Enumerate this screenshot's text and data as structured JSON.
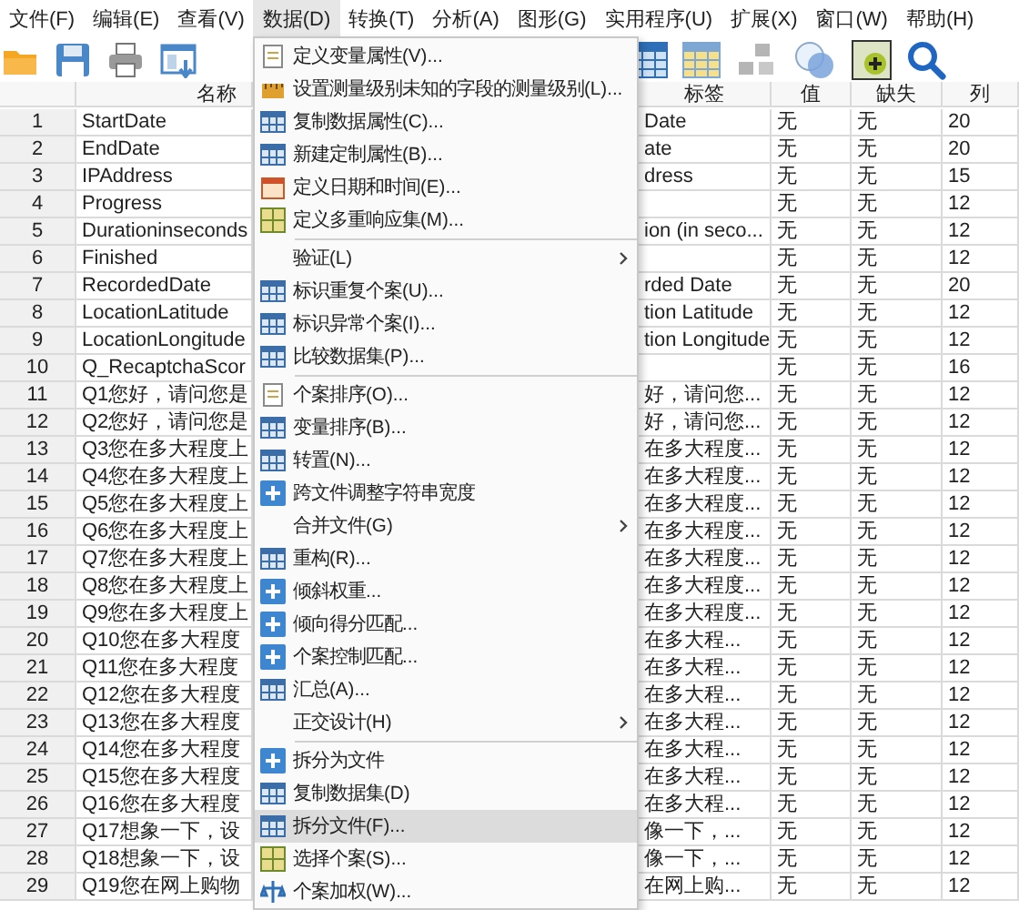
{
  "menu_bar": [
    {
      "label": "文件(F)",
      "selected": false
    },
    {
      "label": "编辑(E)",
      "selected": false
    },
    {
      "label": "查看(V)",
      "selected": false
    },
    {
      "label": "数据(D)",
      "selected": true
    },
    {
      "label": "转换(T)",
      "selected": false
    },
    {
      "label": "分析(A)",
      "selected": false
    },
    {
      "label": "图形(G)",
      "selected": false
    },
    {
      "label": "实用程序(U)",
      "selected": false
    },
    {
      "label": "扩展(X)",
      "selected": false
    },
    {
      "label": "窗口(W)",
      "selected": false
    },
    {
      "label": "帮助(H)",
      "selected": false
    }
  ],
  "table": {
    "columns": [
      "名称",
      "标签",
      "值",
      "缺失",
      "列"
    ],
    "rows": [
      {
        "number": "1",
        "name": "StartDate",
        "label": "Date",
        "values": "无",
        "missing": "无",
        "columns": "20"
      },
      {
        "number": "2",
        "name": "EndDate",
        "label": "ate",
        "values": "无",
        "missing": "无",
        "columns": "20"
      },
      {
        "number": "3",
        "name": "IPAddress",
        "label": "dress",
        "values": "无",
        "missing": "无",
        "columns": "15"
      },
      {
        "number": "4",
        "name": "Progress",
        "label": "",
        "values": "无",
        "missing": "无",
        "columns": "12"
      },
      {
        "number": "5",
        "name": "Durationinseconds",
        "label": "ion (in seco...",
        "values": "无",
        "missing": "无",
        "columns": "12"
      },
      {
        "number": "6",
        "name": "Finished",
        "label": "",
        "values": "无",
        "missing": "无",
        "columns": "12"
      },
      {
        "number": "7",
        "name": "RecordedDate",
        "label": "rded Date",
        "values": "无",
        "missing": "无",
        "columns": "20"
      },
      {
        "number": "8",
        "name": "LocationLatitude",
        "label": "tion Latitude",
        "values": "无",
        "missing": "无",
        "columns": "12"
      },
      {
        "number": "9",
        "name": "LocationLongitude",
        "label": "tion Longitude",
        "values": "无",
        "missing": "无",
        "columns": "12"
      },
      {
        "number": "10",
        "name": "Q_RecaptchaScor",
        "label": "",
        "values": "无",
        "missing": "无",
        "columns": "16"
      },
      {
        "number": "11",
        "name": "Q1您好，请问您是",
        "label": "好，请问您...",
        "values": "无",
        "missing": "无",
        "columns": "12"
      },
      {
        "number": "12",
        "name": "Q2您好，请问您是",
        "label": "好，请问您...",
        "values": "无",
        "missing": "无",
        "columns": "12"
      },
      {
        "number": "13",
        "name": "Q3您在多大程度上",
        "label": "在多大程度...",
        "values": "无",
        "missing": "无",
        "columns": "12"
      },
      {
        "number": "14",
        "name": "Q4您在多大程度上",
        "label": "在多大程度...",
        "values": "无",
        "missing": "无",
        "columns": "12"
      },
      {
        "number": "15",
        "name": "Q5您在多大程度上",
        "label": "在多大程度...",
        "values": "无",
        "missing": "无",
        "columns": "12"
      },
      {
        "number": "16",
        "name": "Q6您在多大程度上",
        "label": "在多大程度...",
        "values": "无",
        "missing": "无",
        "columns": "12"
      },
      {
        "number": "17",
        "name": "Q7您在多大程度上",
        "label": "在多大程度...",
        "values": "无",
        "missing": "无",
        "columns": "12"
      },
      {
        "number": "18",
        "name": "Q8您在多大程度上",
        "label": "在多大程度...",
        "values": "无",
        "missing": "无",
        "columns": "12"
      },
      {
        "number": "19",
        "name": "Q9您在多大程度上",
        "label": "在多大程度...",
        "values": "无",
        "missing": "无",
        "columns": "12"
      },
      {
        "number": "20",
        "name": "Q10您在多大程度",
        "label": "在多大程...",
        "values": "无",
        "missing": "无",
        "columns": "12"
      },
      {
        "number": "21",
        "name": "Q11您在多大程度",
        "label": "在多大程...",
        "values": "无",
        "missing": "无",
        "columns": "12"
      },
      {
        "number": "22",
        "name": "Q12您在多大程度",
        "label": "在多大程...",
        "values": "无",
        "missing": "无",
        "columns": "12"
      },
      {
        "number": "23",
        "name": "Q13您在多大程度",
        "label": "在多大程...",
        "values": "无",
        "missing": "无",
        "columns": "12"
      },
      {
        "number": "24",
        "name": "Q14您在多大程度",
        "label": "在多大程...",
        "values": "无",
        "missing": "无",
        "columns": "12"
      },
      {
        "number": "25",
        "name": "Q15您在多大程度",
        "label": "在多大程...",
        "values": "无",
        "missing": "无",
        "columns": "12"
      },
      {
        "number": "26",
        "name": "Q16您在多大程度",
        "label": "在多大程...",
        "values": "无",
        "missing": "无",
        "columns": "12"
      },
      {
        "number": "27",
        "name": "Q17想象一下，设",
        "label": "像一下，...",
        "values": "无",
        "missing": "无",
        "columns": "12"
      },
      {
        "number": "28",
        "name": "Q18想象一下，设",
        "label": "像一下，...",
        "values": "无",
        "missing": "无",
        "columns": "12"
      },
      {
        "number": "29",
        "name": "Q19您在网上购物",
        "label": "在网上购...",
        "values": "无",
        "missing": "无",
        "columns": "12"
      }
    ]
  },
  "data_menu": {
    "sections": [
      [
        {
          "label": "定义变量属性(V)...",
          "kind": "command",
          "selected": false
        },
        {
          "label": "设置测量级别未知的字段的测量级别(L)...",
          "kind": "command",
          "selected": false
        },
        {
          "label": "复制数据属性(C)...",
          "kind": "command",
          "selected": false
        },
        {
          "label": "新建定制属性(B)...",
          "kind": "command",
          "selected": false
        },
        {
          "label": "定义日期和时间(E)...",
          "kind": "command",
          "selected": false
        },
        {
          "label": "定义多重响应集(M)...",
          "kind": "command",
          "selected": false
        }
      ],
      [
        {
          "label": "验证(L)",
          "kind": "submenu",
          "selected": false
        },
        {
          "label": "标识重复个案(U)...",
          "kind": "command",
          "selected": false
        },
        {
          "label": "标识异常个案(I)...",
          "kind": "command",
          "selected": false
        },
        {
          "label": "比较数据集(P)...",
          "kind": "command",
          "selected": false
        }
      ],
      [
        {
          "label": "个案排序(O)...",
          "kind": "command",
          "selected": false
        },
        {
          "label": "变量排序(B)...",
          "kind": "command",
          "selected": false
        },
        {
          "label": "转置(N)...",
          "kind": "command",
          "selected": false
        },
        {
          "label": "跨文件调整字符串宽度",
          "kind": "command",
          "selected": false
        },
        {
          "label": "合并文件(G)",
          "kind": "submenu",
          "selected": false
        },
        {
          "label": "重构(R)...",
          "kind": "command",
          "selected": false
        },
        {
          "label": "倾斜权重...",
          "kind": "command",
          "selected": false
        },
        {
          "label": "倾向得分匹配...",
          "kind": "command",
          "selected": false
        },
        {
          "label": "个案控制匹配...",
          "kind": "command",
          "selected": false
        },
        {
          "label": "汇总(A)...",
          "kind": "command",
          "selected": false
        },
        {
          "label": "正交设计(H)",
          "kind": "submenu",
          "selected": false
        }
      ],
      [
        {
          "label": "拆分为文件",
          "kind": "command",
          "selected": false
        },
        {
          "label": "复制数据集(D)",
          "kind": "command",
          "selected": false
        },
        {
          "label": "拆分文件(F)...",
          "kind": "command",
          "selected": true
        },
        {
          "label": "选择个案(S)...",
          "kind": "command",
          "selected": false
        },
        {
          "label": "个案加权(W)...",
          "kind": "command",
          "selected": false
        }
      ]
    ]
  }
}
